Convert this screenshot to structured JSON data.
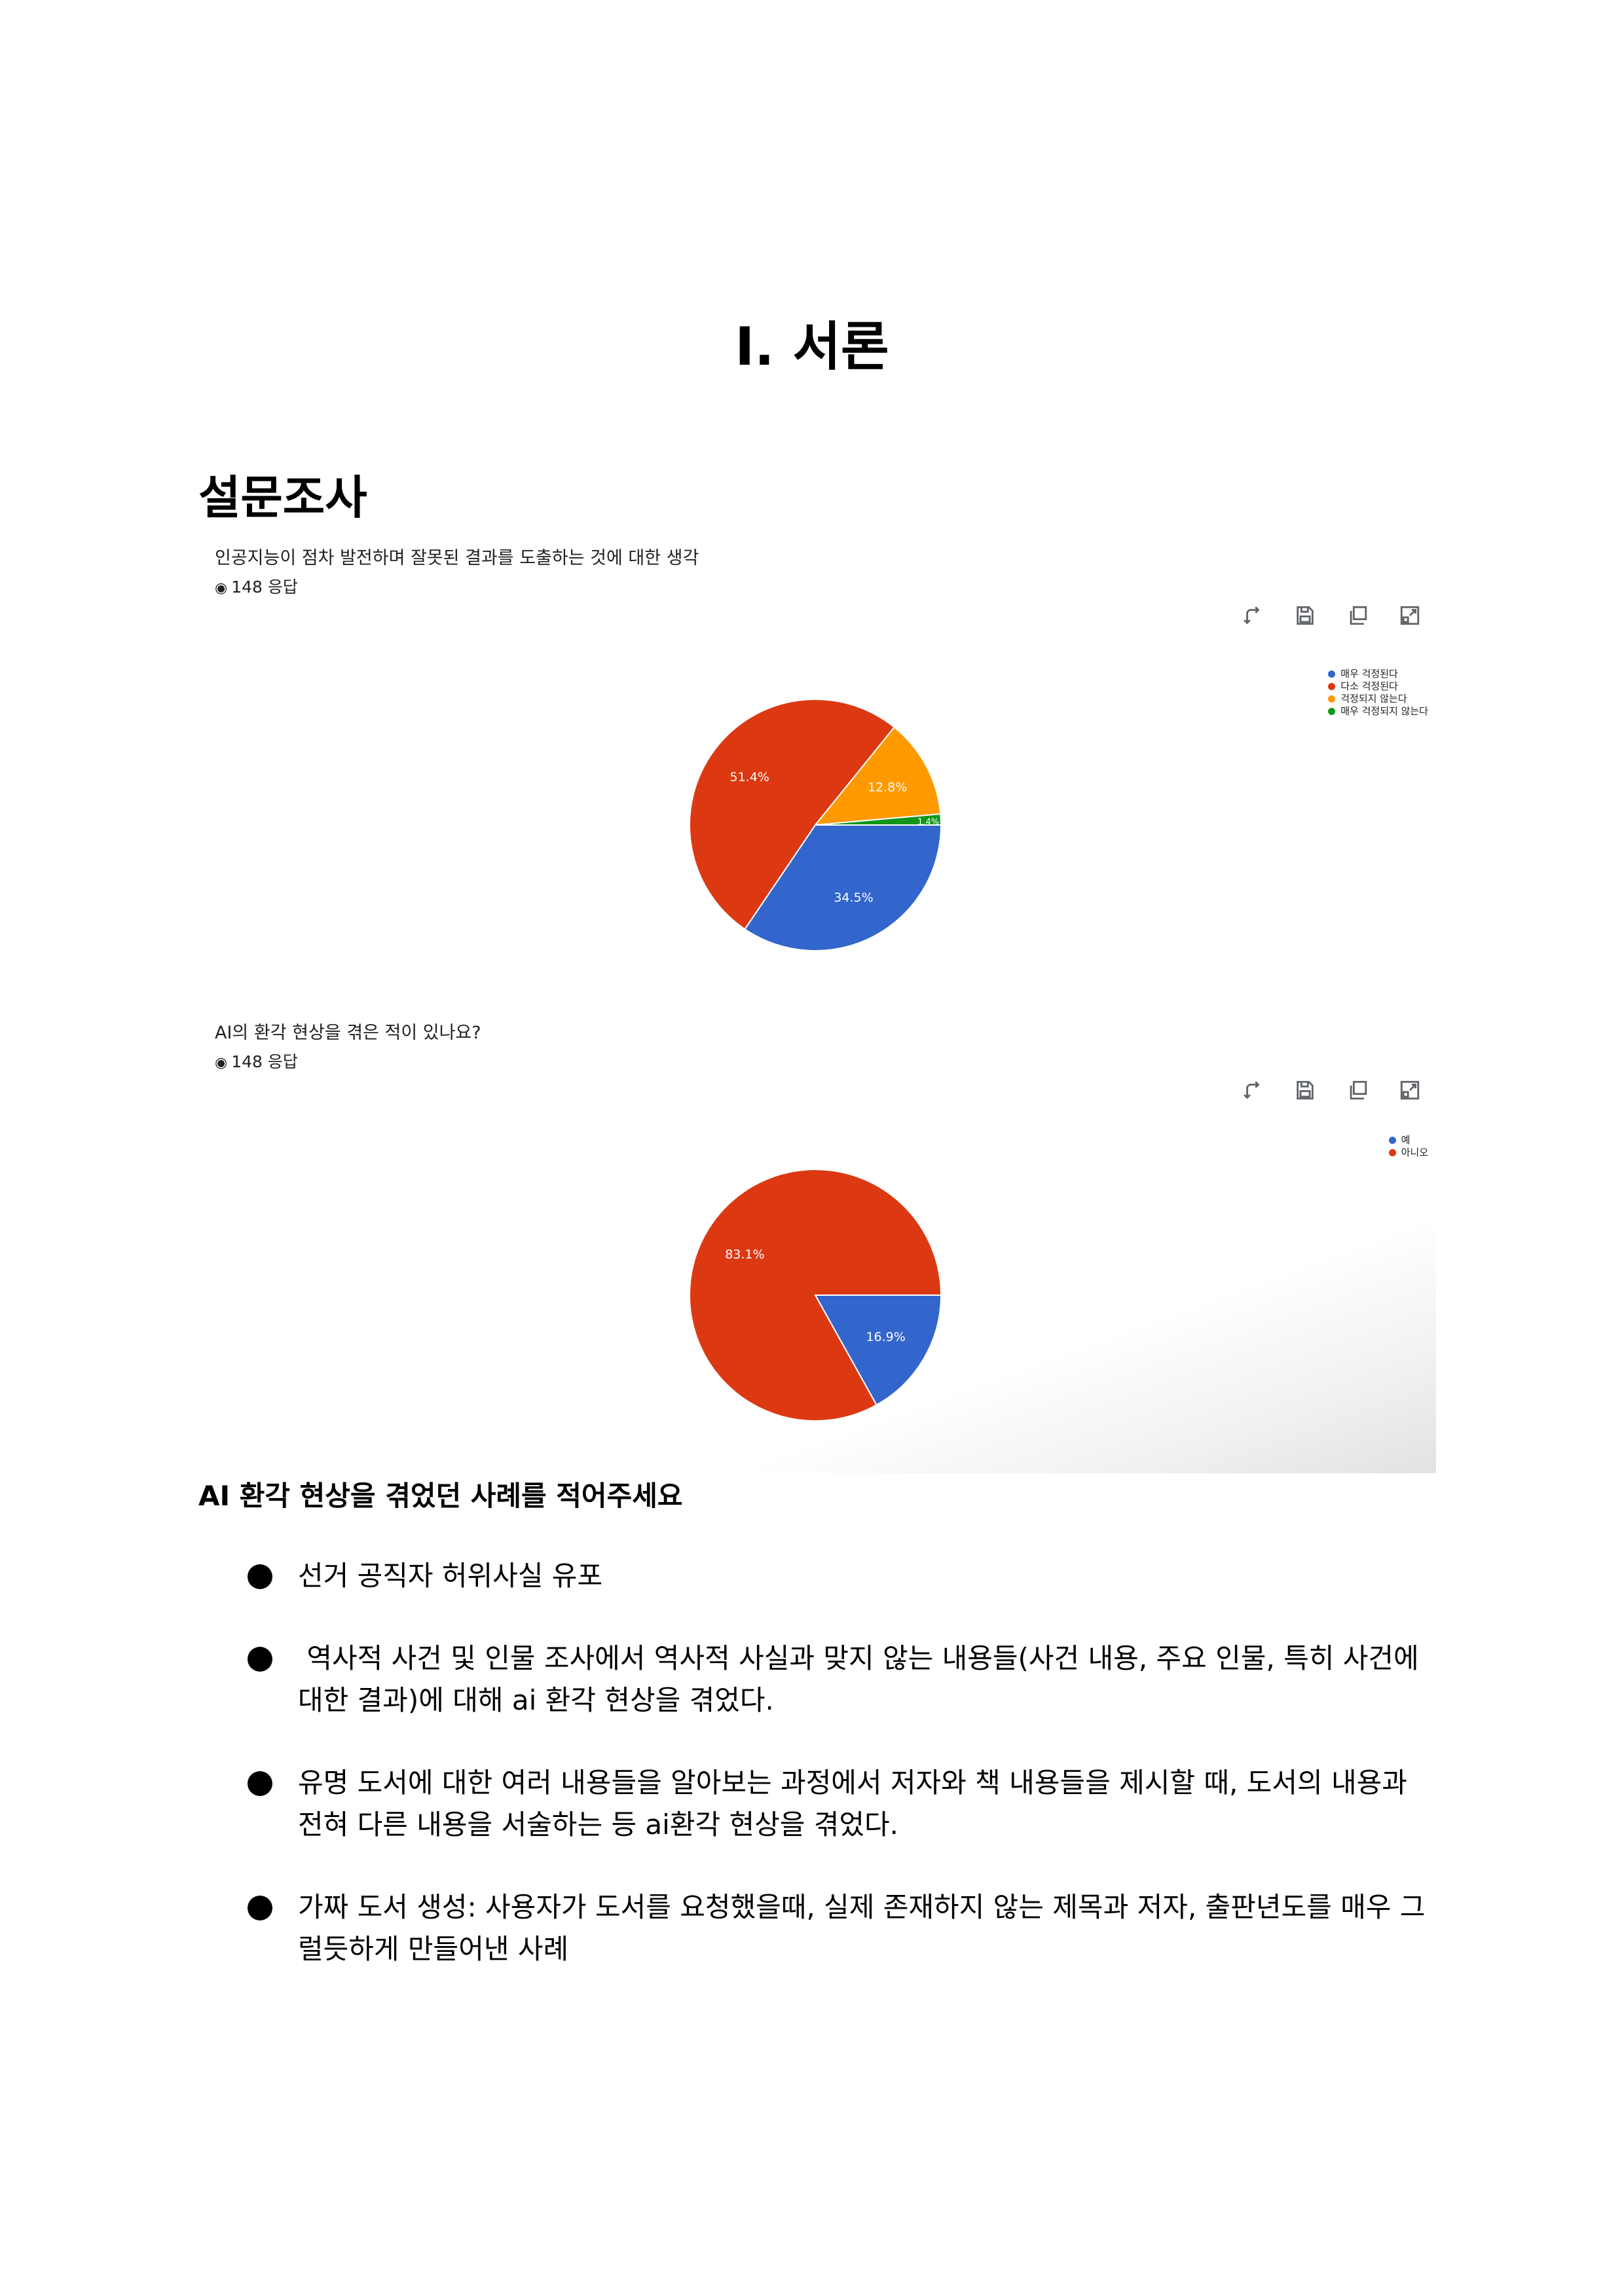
{
  "page_title": "I. 서론",
  "section_heading": "설문조사",
  "surveys": [
    {
      "question": "인공지능이 점차 발전하며 잘못된 결과를 도출하는 것에 대한 생각",
      "responses": "148 응답",
      "toolbar_icons": [
        "transpose-icon",
        "save-icon",
        "copy-icon",
        "expand-icon"
      ]
    },
    {
      "question": "AI의 환각 현상을 겪은 적이 있나요?",
      "responses": "148 응답",
      "toolbar_icons": [
        "transpose-icon",
        "save-icon",
        "copy-icon",
        "expand-icon"
      ]
    }
  ],
  "chart_data": [
    {
      "type": "pie",
      "title": "인공지능이 점차 발전하며 잘못된 결과를 도출하는 것에 대한 생각",
      "categories": [
        "매우 걱정된다",
        "다소 걱정된다",
        "걱정되지 않는다",
        "매우 걱정되지 않는다"
      ],
      "values": [
        34.5,
        51.4,
        12.8,
        1.4
      ],
      "labels": [
        "34.5%",
        "51.4%",
        "12.8%",
        "1.4%"
      ],
      "colors": [
        "#3366cc",
        "#dc3912",
        "#ff9900",
        "#109618"
      ],
      "legend": "top-right"
    },
    {
      "type": "pie",
      "title": "AI의 환각 현상을 겪은 적이 있나요?",
      "categories": [
        "예",
        "아니오"
      ],
      "values": [
        16.9,
        83.1
      ],
      "labels": [
        "16.9%",
        "83.1%"
      ],
      "colors": [
        "#3366cc",
        "#dc3912"
      ],
      "legend": "top-right"
    }
  ],
  "case_heading": "AI 환각 현상을 겪었던 사례를 적어주세요",
  "cases": [
    "선거 공직자 허위사실 유포",
    " 역사적 사건 및 인물 조사에서 역사적 사실과 맞지 않는 내용들(사건 내용, 주요 인물, 특히 사건에 대한 결과)에 대해 ai 환각 현상을 겪었다.",
    "유명 도서에 대한 여러 내용들을 알아보는 과정에서 저자와 책 내용들을 제시할 때, 도서의 내용과 전혀 다른 내용을 서술하는 등 ai환각 현상을 겪었다.",
    "가짜 도서 생성: 사용자가 도서를 요청했을때, 실제 존재하지 않는 제목과 저자, 출판년도를 매우 그럴듯하게 만들어낸 사례"
  ]
}
